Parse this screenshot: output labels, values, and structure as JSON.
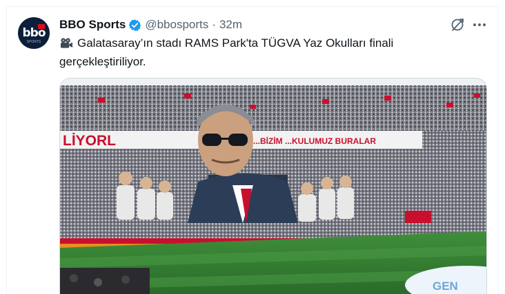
{
  "tweet": {
    "author_name": "BBO Sports",
    "handle": "@bbosports",
    "separator": "·",
    "time": "32m",
    "text_line1": "Galatasaray’ın stadı RAMS Park'ta TÜGVA Yaz Okulları finali",
    "text_line2": "gerçekleştiriliyor.",
    "avatar_text": "bbo",
    "avatar_sub": "SPORTS"
  },
  "media": {
    "banner_left": "LİYORL",
    "banner_right": "...BİZİM ...KULUMUZ BURALAR",
    "pitch_board": "GEN"
  },
  "colors": {
    "verified": "#1d9bf0",
    "muted_text": "#536471",
    "pitch": "#2e7d32"
  },
  "icons": [
    "verified-icon",
    "grok-icon",
    "more-icon",
    "camera-icon"
  ]
}
